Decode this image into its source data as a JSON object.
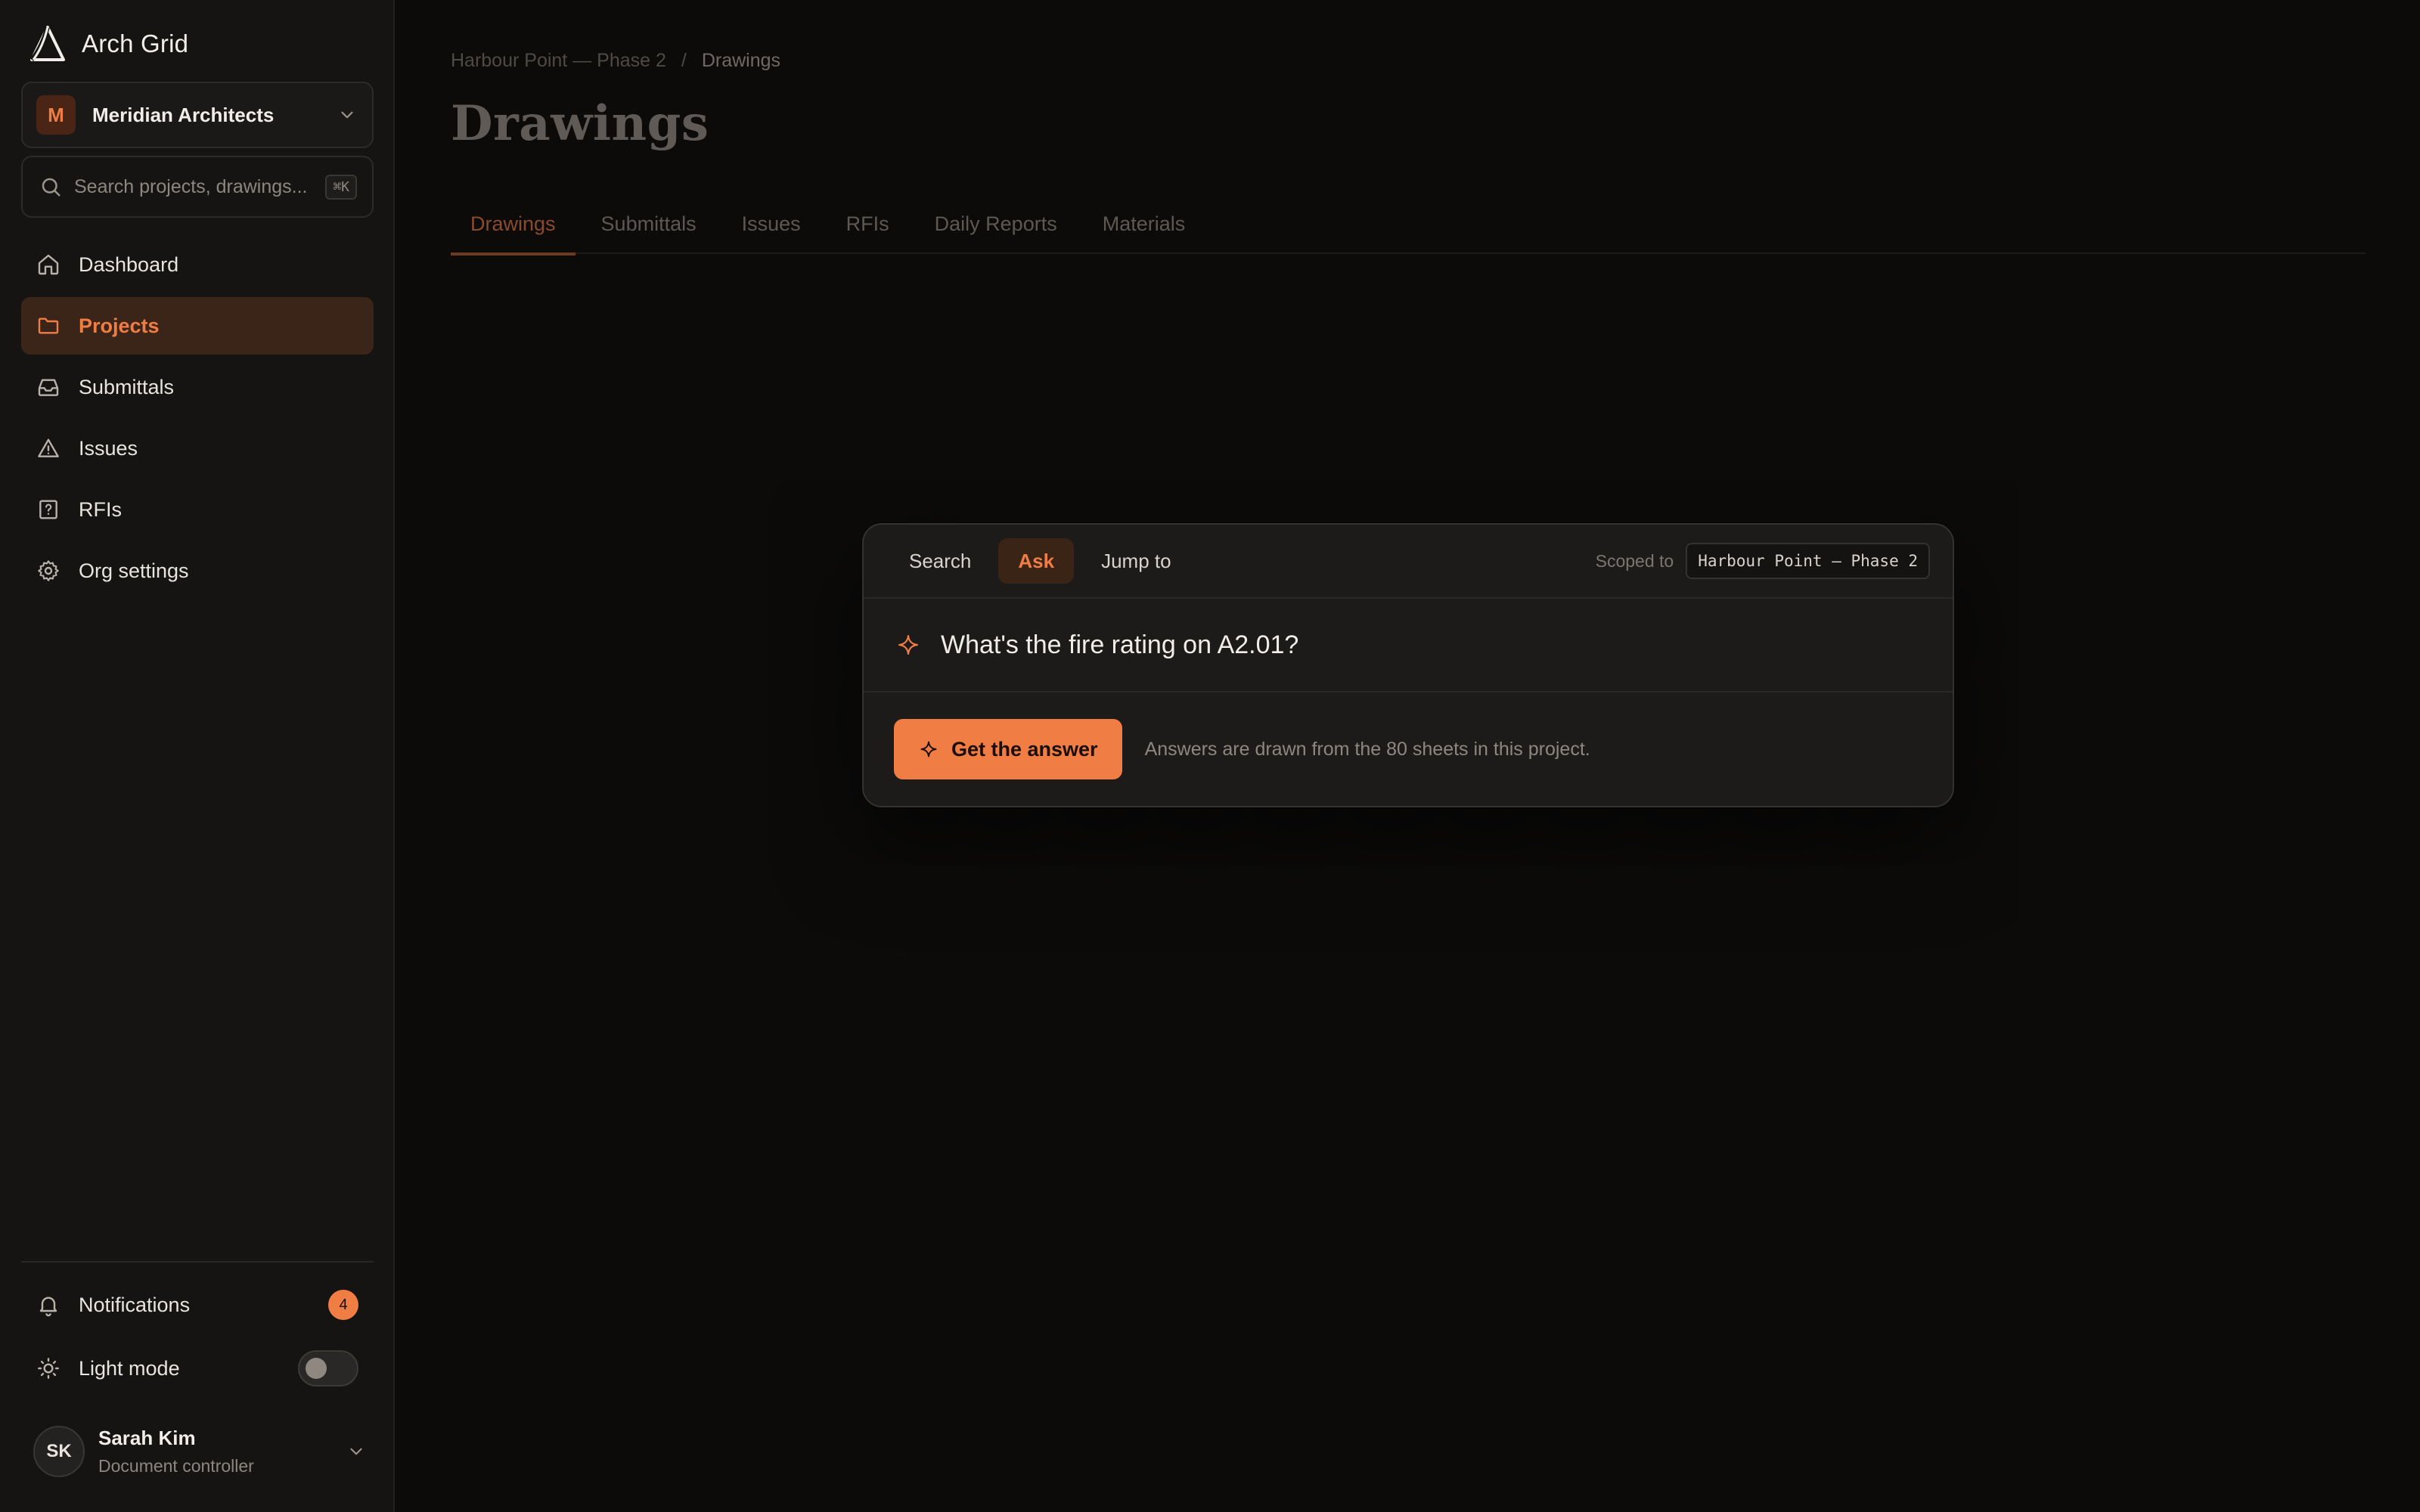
{
  "app": {
    "name": "Arch Grid",
    "org_name": "Meridian Architects",
    "org_initial": "M"
  },
  "sidebar": {
    "search_placeholder": "Search projects, drawings...",
    "search_shortcut": "⌘K",
    "items": [
      {
        "label": "Dashboard",
        "icon": "home-icon",
        "active": false
      },
      {
        "label": "Projects",
        "icon": "folder-icon",
        "active": true
      },
      {
        "label": "Submittals",
        "icon": "inbox-icon",
        "active": false
      },
      {
        "label": "Issues",
        "icon": "alert-triangle-icon",
        "active": false
      },
      {
        "label": "RFIs",
        "icon": "help-square-icon",
        "active": false
      },
      {
        "label": "Org settings",
        "icon": "gear-icon",
        "active": false
      }
    ],
    "notifications": {
      "label": "Notifications",
      "count": "4"
    },
    "light_mode": {
      "label": "Light mode",
      "enabled": false
    },
    "user": {
      "initials": "SK",
      "name": "Sarah Kim",
      "role": "Document controller"
    }
  },
  "main": {
    "breadcrumb": {
      "project": "Harbour Point — Phase 2",
      "separator": "/",
      "current": "Drawings"
    },
    "title": "Drawings",
    "tabs": [
      {
        "label": "Drawings",
        "active": true
      },
      {
        "label": "Submittals",
        "active": false
      },
      {
        "label": "Issues",
        "active": false
      },
      {
        "label": "RFIs",
        "active": false
      },
      {
        "label": "Daily Reports",
        "active": false
      },
      {
        "label": "Materials",
        "active": false
      }
    ]
  },
  "palette": {
    "modes": [
      {
        "label": "Search",
        "active": false
      },
      {
        "label": "Ask",
        "active": true
      },
      {
        "label": "Jump to",
        "active": false
      }
    ],
    "scope_label": "Scoped to",
    "scope_value": "Harbour Point — Phase 2",
    "query": "What's the fire rating on A2.01?",
    "submit_label": "Get the answer",
    "footnote": "Answers are drawn from the 80 sheets in this project."
  },
  "colors": {
    "accent": "#f07d44",
    "sidebar_bg": "#151413",
    "page_bg": "#0c0b0a",
    "palette_bg": "#1c1b19"
  }
}
